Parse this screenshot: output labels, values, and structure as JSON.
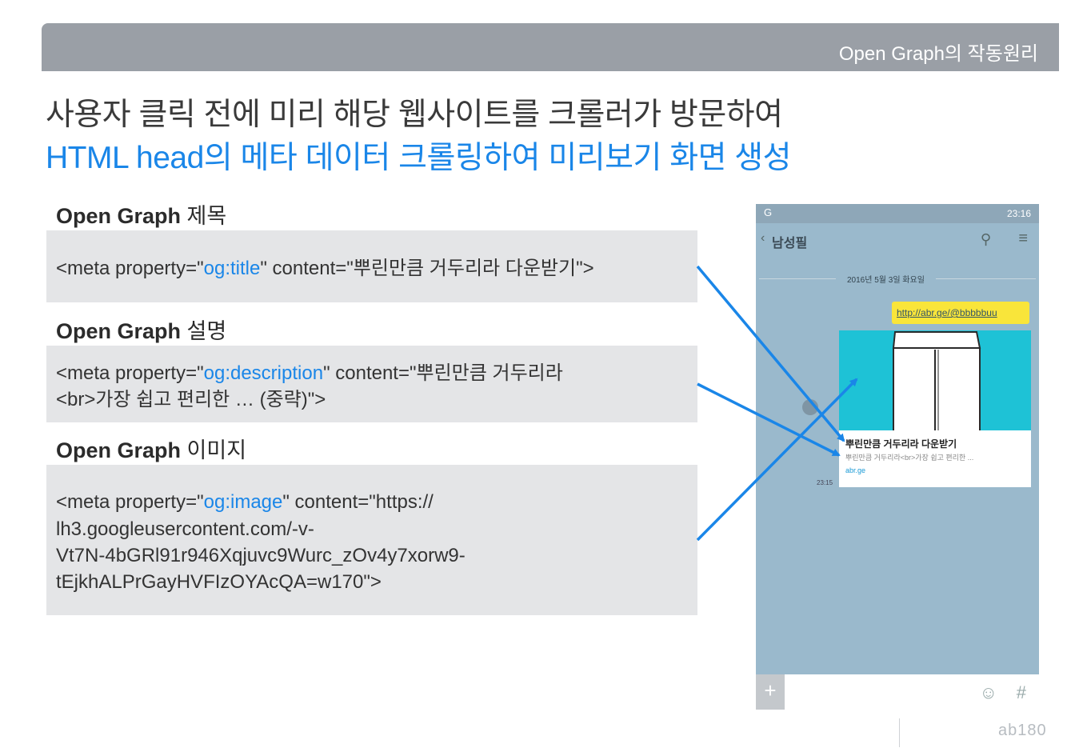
{
  "header": {
    "title": "Open Graph의 작동원리"
  },
  "headline": {
    "line1": "사용자 클릭 전에 미리 해당 웹사이트를 크롤러가 방문하여",
    "line2": "HTML head의 메타 데이터 크롤링하여 미리보기 화면 생성"
  },
  "sections": [
    {
      "label_bold": "Open Graph",
      "label_rest": " 제목",
      "code_lines": [
        {
          "pre": "<meta property=\"",
          "hl": "og:title",
          "post": "\" content=\"뿌린만큼 거두리라 다운받기\">"
        }
      ]
    },
    {
      "label_bold": "Open Graph",
      "label_rest": " 설명",
      "code_lines": [
        {
          "pre": "<meta property=\"",
          "hl": "og:description",
          "post": "\" content=\"뿌린만큼 거두리라"
        },
        {
          "pre": "<br>가장 쉽고 편리한 … (중략)\">",
          "hl": "",
          "post": ""
        }
      ]
    },
    {
      "label_bold": "Open Graph",
      "label_rest": " 이미지",
      "code_lines": [
        {
          "pre": "<meta property=\"",
          "hl": "og:image",
          "post": "\" content=\"https://"
        },
        {
          "pre": "lh3.googleusercontent.com/-v-",
          "hl": "",
          "post": ""
        },
        {
          "pre": "Vt7N-4bGRl91r946Xqjuvc9Wurc_zOv4y7xorw9-",
          "hl": "",
          "post": ""
        },
        {
          "pre": "tEjkhALPrGayHVFIzOYAcQA=w170\">",
          "hl": "",
          "post": ""
        }
      ]
    }
  ],
  "phone": {
    "status_left": "G",
    "status_right": "23:16",
    "chat_name": "남성필",
    "date": "2016년 5월 3일 화요일",
    "link": "http://abr.ge/@bbbbbuu",
    "card_title": "뿌린만큼 거두리라 다운받기",
    "card_desc": "뿌린만큼 거두리라<br>가장 쉽고 편리한 ...",
    "card_link": "abr.ge",
    "time": "23:15",
    "plus": "+",
    "hash": "#"
  },
  "footer": {
    "logo": "ab180"
  },
  "colors": {
    "accent": "#1a86e8",
    "bar": "#9a9fa6",
    "card_teal": "#1ec2d6",
    "bubble": "#f9e53a"
  }
}
